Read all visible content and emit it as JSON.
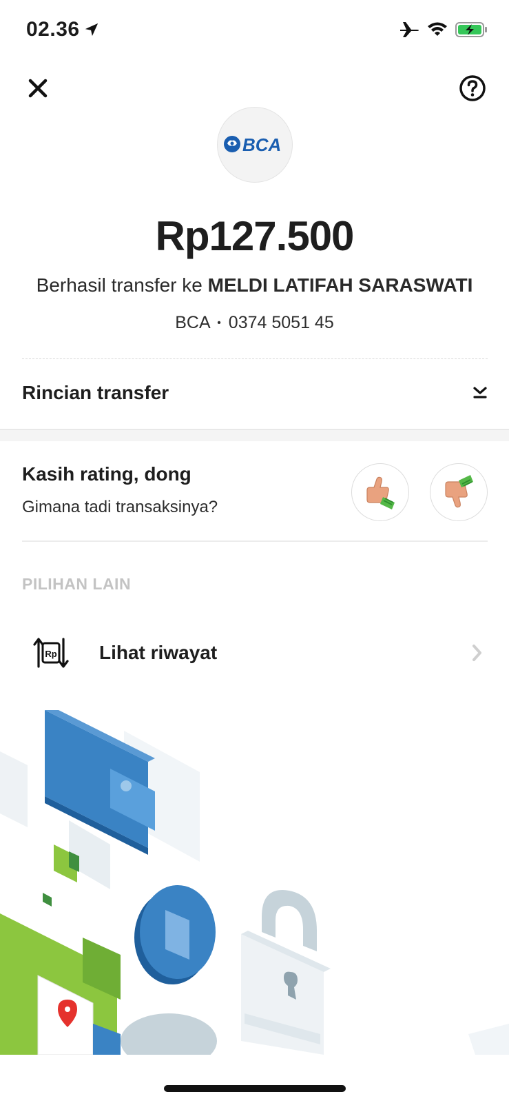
{
  "status_bar": {
    "time": "02.36",
    "icons": [
      "location-arrow-icon",
      "airplane-icon",
      "wifi-icon",
      "battery-charging-icon"
    ]
  },
  "header": {
    "close_icon": "close-icon",
    "help_icon": "help-icon"
  },
  "transfer": {
    "bank_logo_text": "BCA",
    "amount": "Rp127.500",
    "success_prefix": "Berhasil transfer ke ",
    "recipient_name": "MELDI LATIFAH SARASWATI",
    "bank_name": "BCA",
    "separator": "•",
    "account_number": "0374 5051 45"
  },
  "details": {
    "label": "Rincian transfer",
    "icon": "chevron-down-icon"
  },
  "rating": {
    "title": "Kasih rating, dong",
    "subtitle": "Gimana tadi transaksinya?",
    "thumb_up_icon": "thumbs-up-icon",
    "thumb_down_icon": "thumbs-down-icon"
  },
  "other_options": {
    "heading": "PILIHAN LAIN",
    "items": [
      {
        "label": "Lihat riwayat",
        "icon": "history-rp-icon",
        "icon_text": "Rp"
      }
    ]
  },
  "colors": {
    "brand_blue": "#1a5eb0",
    "green": "#7cb83a",
    "muted_heading": "#c3c3c3"
  }
}
